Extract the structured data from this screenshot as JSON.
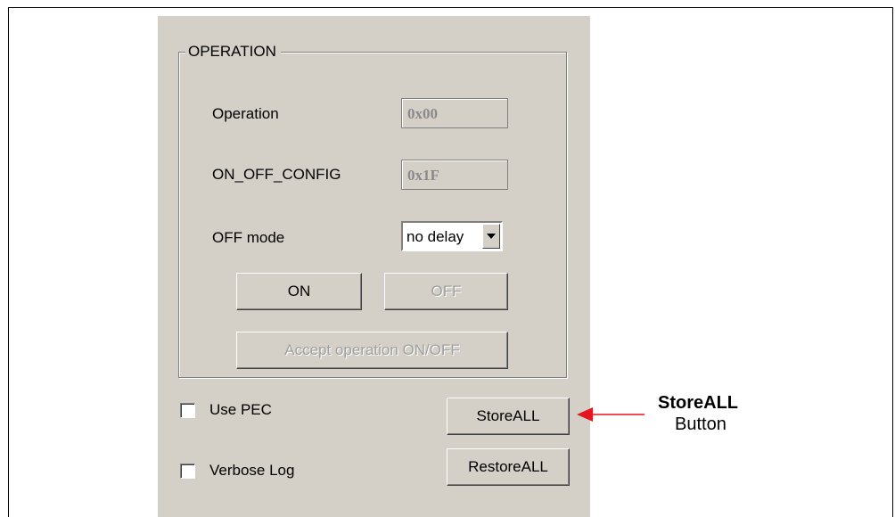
{
  "operation_group": {
    "title": "OPERATION",
    "operation": {
      "label": "Operation",
      "value": "0x00"
    },
    "on_off_config": {
      "label": "ON_OFF_CONFIG",
      "value": "0x1F"
    },
    "off_mode": {
      "label": "OFF mode",
      "selected": "no delay"
    },
    "on_button": "ON",
    "off_button": "OFF",
    "accept_button": "Accept operation ON/OFF"
  },
  "options": {
    "use_pec": {
      "label": "Use PEC",
      "checked": false
    },
    "verbose_log": {
      "label": "Verbose Log",
      "checked": false
    }
  },
  "actions": {
    "store_all": "StoreALL",
    "restore_all": "RestoreALL"
  },
  "annotation": {
    "title": "StoreALL",
    "subtitle": "Button",
    "arrow_color": "#e8141e"
  },
  "colors": {
    "panel_bg": "#d4d0c8",
    "disabled_text": "#8a8a8a"
  }
}
